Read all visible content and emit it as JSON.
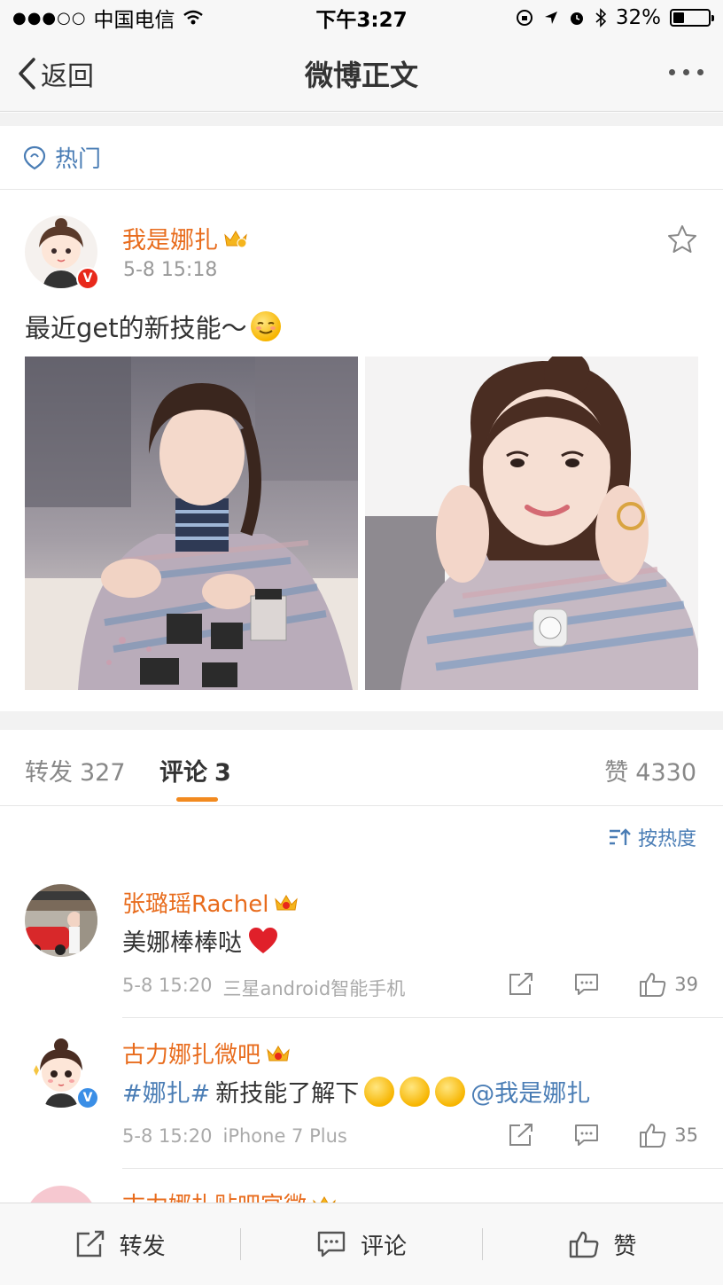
{
  "statusbar": {
    "carrier": "中国电信",
    "time": "下午3:27",
    "battery": "32%",
    "battery_level": 0.32
  },
  "nav": {
    "back_label": "返回",
    "title": "微博正文"
  },
  "hot_label": "热门",
  "post": {
    "author": "我是娜扎",
    "time": "5-8 15:18",
    "text": "最近get的新技能～",
    "badge": "V"
  },
  "tabs": {
    "repost_label": "转发",
    "repost_count": "327",
    "comment_label": "评论",
    "comment_count": "3",
    "like_label": "赞",
    "like_count": "4330"
  },
  "sort_label": "按热度",
  "comments": [
    {
      "name": "张璐瑶Rachel",
      "text": "美娜棒棒哒",
      "time": "5-8 15:20",
      "source": "三星android智能手机",
      "likes": "39"
    },
    {
      "name": "古力娜扎微吧",
      "topic": "#娜扎#",
      "text": "新技能了解下",
      "mention": "@我是娜扎",
      "time": "5-8 15:20",
      "source": "iPhone 7 Plus",
      "likes": "35",
      "badge": "V"
    },
    {
      "name": "古力娜扎贴吧官微"
    }
  ],
  "bottom": {
    "repost": "转发",
    "comment": "评论",
    "like": "赞"
  },
  "colors": {
    "accent_orange": "#e86c1d",
    "link_blue": "#4a7db5",
    "tab_underline": "#f28a1f"
  }
}
